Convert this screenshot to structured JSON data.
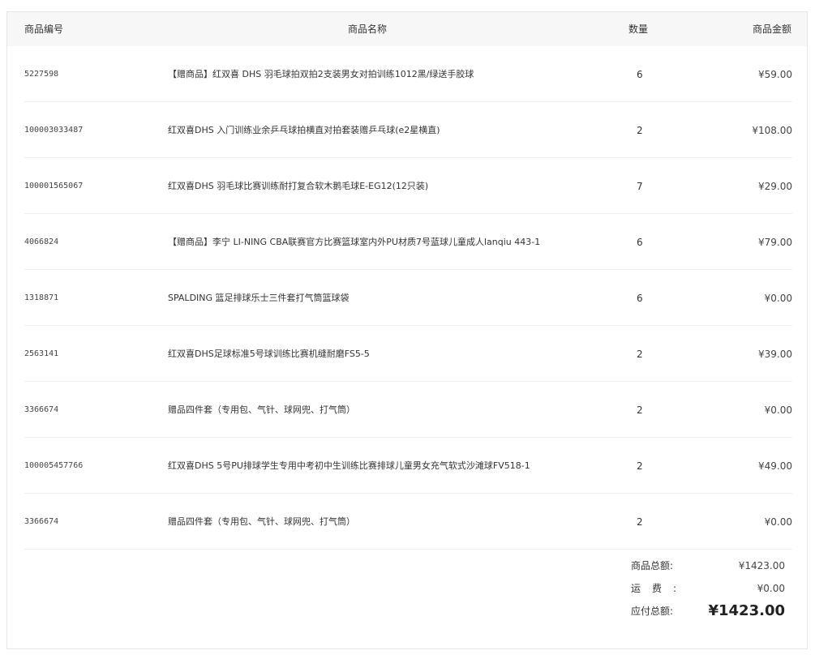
{
  "table": {
    "headers": {
      "id": "商品编号",
      "name": "商品名称",
      "qty": "数量",
      "amount": "商品金额"
    },
    "rows": [
      {
        "id": "5227598",
        "name": "【赠商品】红双喜 DHS 羽毛球拍双拍2支装男女对拍训练1012黑/绿送手胶球",
        "qty": "6",
        "amount": "¥59.00"
      },
      {
        "id": "100003033487",
        "name": "红双喜DHS 入门训练业余乒乓球拍横直对拍套装赠乒乓球(e2星横直)",
        "qty": "2",
        "amount": "¥108.00"
      },
      {
        "id": "100001565067",
        "name": "红双喜DHS 羽毛球比赛训练耐打复合软木鹅毛球E-EG12(12只装)",
        "qty": "7",
        "amount": "¥29.00"
      },
      {
        "id": "4066824",
        "name": "【赠商品】李宁 LI-NING CBA联赛官方比赛篮球室内外PU材质7号蓝球儿童成人lanqiu 443-1",
        "qty": "6",
        "amount": "¥79.00"
      },
      {
        "id": "1318871",
        "name": "SPALDING 篮足排球乐士三件套打气筒篮球袋",
        "qty": "6",
        "amount": "¥0.00"
      },
      {
        "id": "2563141",
        "name": "红双喜DHS足球标准5号球训练比赛机缝耐磨FS5-5",
        "qty": "2",
        "amount": "¥39.00"
      },
      {
        "id": "3366674",
        "name": "赠品四件套（专用包、气针、球网兜、打气筒）",
        "qty": "2",
        "amount": "¥0.00"
      },
      {
        "id": "100005457766",
        "name": "红双喜DHS 5号PU排球学生专用中考初中生训练比赛排球儿童男女充气软式沙滩球FV518-1",
        "qty": "2",
        "amount": "¥49.00"
      },
      {
        "id": "3366674",
        "name": "赠品四件套（专用包、气针、球网兜、打气筒）",
        "qty": "2",
        "amount": "¥0.00"
      }
    ]
  },
  "summary": {
    "subtotal_label": "商品总额:",
    "subtotal_value": "¥1423.00",
    "shipping_label": "运费:",
    "shipping_value": "¥0.00",
    "total_label": "应付总额:",
    "total_value": "¥1423.00"
  }
}
